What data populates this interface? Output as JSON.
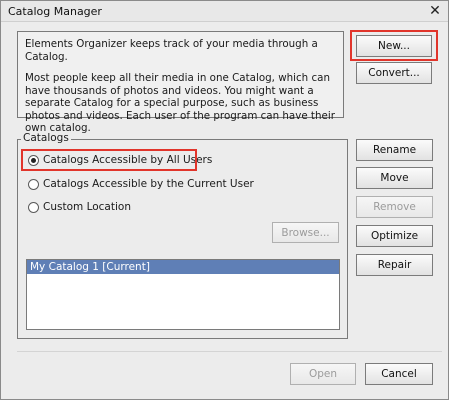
{
  "window": {
    "title": "Catalog Manager",
    "close_glyph": "✕"
  },
  "info": {
    "paragraph1": "Elements Organizer keeps track of your media through a Catalog.",
    "paragraph2": "Most people keep all their media in one Catalog, which can have thousands of photos and videos. You might want a separate Catalog for a special purpose, such as business photos and videos. Each user of the program can have their own catalog."
  },
  "buttons": {
    "new": "New...",
    "convert": "Convert...",
    "rename": "Rename",
    "move": "Move",
    "remove": "Remove",
    "optimize": "Optimize",
    "repair": "Repair",
    "browse": "Browse...",
    "open": "Open",
    "cancel": "Cancel"
  },
  "catalogs": {
    "legend": "Catalogs",
    "options": [
      {
        "label": "Catalogs Accessible by All Users",
        "checked": true
      },
      {
        "label": "Catalogs Accessible by the Current User",
        "checked": false
      },
      {
        "label": "Custom Location",
        "checked": false
      }
    ],
    "list": [
      "My Catalog 1 [Current]"
    ]
  },
  "colors": {
    "highlight": "#e1352b",
    "selection": "#5f7fb6"
  }
}
